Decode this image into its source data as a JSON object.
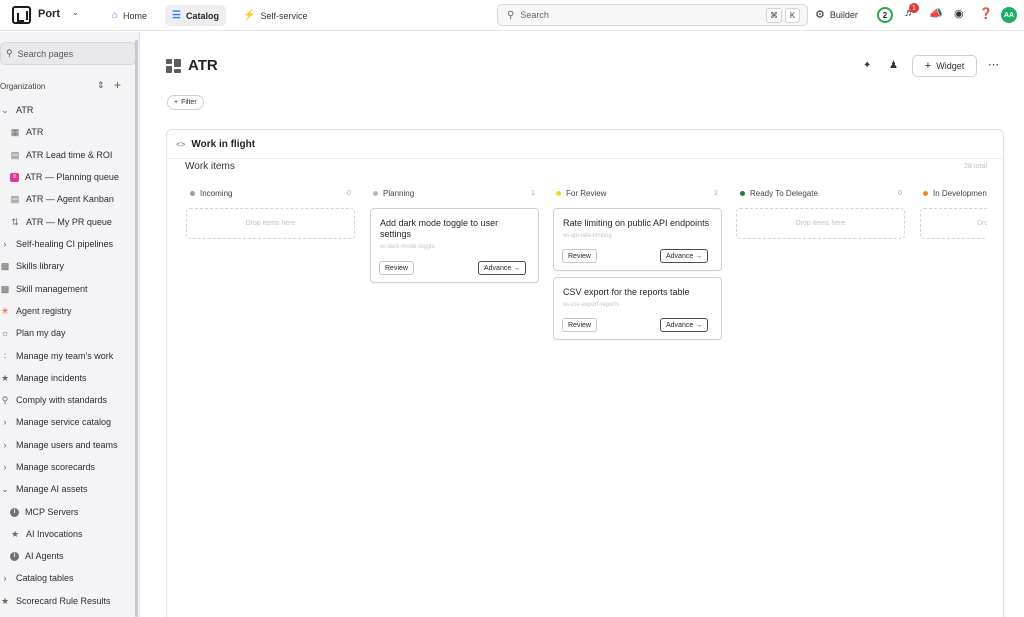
{
  "topbar": {
    "org": "Port",
    "nav": [
      {
        "label": "Home",
        "icon": "home-icon"
      },
      {
        "label": "Catalog",
        "icon": "list-icon",
        "active": true
      },
      {
        "label": "Self-service",
        "icon": "bolt-icon"
      }
    ],
    "search_placeholder": "Search",
    "shortcut_cmd": "⌘",
    "shortcut_key": "K",
    "builder": "Builder",
    "onboarding_step": "2",
    "notification_count": "1",
    "avatar_initials": "AA"
  },
  "sidebar": {
    "search_placeholder": "Search pages",
    "org_label": "Organization",
    "items": [
      {
        "label": "ATR",
        "icon": "chevron-down-icon"
      },
      {
        "label": "ATR",
        "icon": "dashboard-icon"
      },
      {
        "label": "ATR Lead time & ROI",
        "icon": "table-icon"
      },
      {
        "label": "ATR — Planning queue",
        "icon": "pink-entity-icon"
      },
      {
        "label": "ATR — Agent Kanban",
        "icon": "table-icon"
      },
      {
        "label": "ATR — My PR queue",
        "icon": "pull-request-icon"
      },
      {
        "label": "Self-healing CI pipelines",
        "icon": "chevron-right-icon"
      },
      {
        "label": "Skills library",
        "icon": "book-icon"
      },
      {
        "label": "Skill management",
        "icon": "book-icon"
      },
      {
        "label": "Agent registry",
        "icon": "spark-icon"
      },
      {
        "label": "Plan my day",
        "icon": "sun-icon"
      },
      {
        "label": "Manage my team's work",
        "icon": "team-icon"
      },
      {
        "label": "Manage incidents",
        "icon": "alert-icon"
      },
      {
        "label": "Comply with standards",
        "icon": "trophy-icon"
      },
      {
        "label": "Manage service catalog",
        "icon": "chevron-right-icon"
      },
      {
        "label": "Manage users and teams",
        "icon": "chevron-right-icon"
      },
      {
        "label": "Manage scorecards",
        "icon": "chevron-right-icon"
      },
      {
        "label": "Manage AI assets",
        "icon": "chevron-down-icon"
      },
      {
        "label": "MCP Servers",
        "icon": "info-icon"
      },
      {
        "label": "AI Invocations",
        "icon": "star-icon"
      },
      {
        "label": "AI Agents",
        "icon": "info-icon"
      },
      {
        "label": "Catalog tables",
        "icon": "chevron-right-icon"
      },
      {
        "label": "Scorecard Rule Results",
        "icon": "alert-icon"
      }
    ]
  },
  "page": {
    "title": "ATR",
    "widget_button": "Widget",
    "filter_button": "Filter"
  },
  "widget": {
    "title": "Work in flight",
    "section_label": "Work items",
    "total_label": "28 total",
    "drop_text": "Drop items here",
    "columns": [
      {
        "name": "Incoming",
        "count": "0",
        "color": "#9a9ba1"
      },
      {
        "name": "Planning",
        "count": "1",
        "color": "#b8b9be"
      },
      {
        "name": "For Review",
        "count": "2",
        "color": "#f2d024"
      },
      {
        "name": "Ready To Delegate",
        "count": "0",
        "color": "#1f7a3a"
      },
      {
        "name": "In Development",
        "count": "",
        "color": "#f08a24"
      }
    ],
    "cards": [
      {
        "title": "Add dark mode toggle to user settings",
        "id": "wi-dark-mode-toggle",
        "review": "Review",
        "advance": "Advance →"
      },
      {
        "title": "Rate limiting on public API endpoints",
        "id": "wi-api-rate-limiting",
        "review": "Review",
        "advance": "Advance →"
      },
      {
        "title": "CSV export for the reports table",
        "id": "wi-csv-export-reports",
        "review": "Review",
        "advance": "Advance →"
      }
    ]
  }
}
